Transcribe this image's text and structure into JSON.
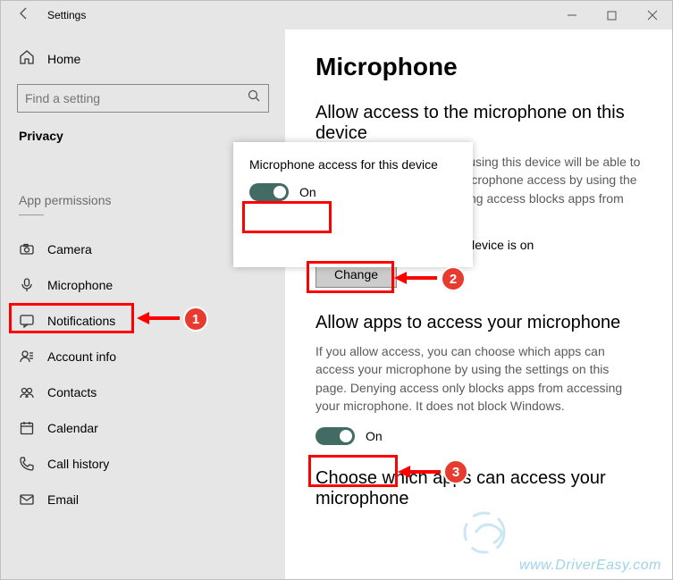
{
  "window": {
    "title": "Settings"
  },
  "sidebar": {
    "home": "Home",
    "search_placeholder": "Find a setting",
    "category": "Privacy",
    "section_label": "App permissions",
    "items": [
      {
        "label": "Camera"
      },
      {
        "label": "Microphone"
      },
      {
        "label": "Notifications"
      },
      {
        "label": "Account info"
      },
      {
        "label": "Contacts"
      },
      {
        "label": "Calendar"
      },
      {
        "label": "Call history"
      },
      {
        "label": "Email"
      }
    ]
  },
  "main": {
    "heading": "Microphone",
    "section1": {
      "title": "Allow access to the microphone on this device",
      "desc": "If you allow access, people using this device will be able to choose if their apps have microphone access by using the settings on this page. Denying access blocks apps from accessing the microphone.",
      "status": "Microphone access for this device is on",
      "change_label": "Change"
    },
    "section2": {
      "title": "Allow apps to access your microphone",
      "desc": "If you allow access, you can choose which apps can access your microphone by using the settings on this page. Denying access only blocks apps from accessing your microphone. It does not block Windows.",
      "toggle_state": "On"
    },
    "section3": {
      "title": "Choose which apps can access your microphone"
    }
  },
  "popup": {
    "title": "Microphone access for this device",
    "toggle_state": "On"
  },
  "annotations": {
    "badge1": "1",
    "badge2": "2",
    "badge3": "3"
  },
  "watermark": "www.DriverEasy.com"
}
